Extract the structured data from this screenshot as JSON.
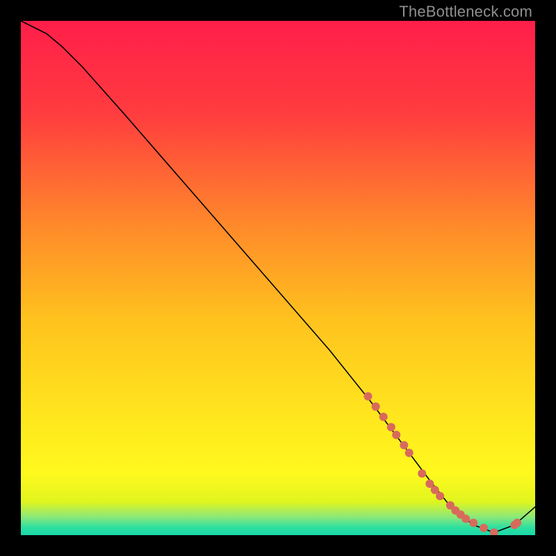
{
  "watermark": "TheBottleneck.com",
  "chart_data": {
    "type": "line",
    "title": "",
    "xlabel": "",
    "ylabel": "",
    "xlim": [
      0,
      100
    ],
    "ylim": [
      0,
      100
    ],
    "grid": false,
    "legend": false,
    "series": [
      {
        "name": "curve",
        "x": [
          0,
          2,
          5,
          8,
          12,
          20,
          30,
          40,
          50,
          60,
          68,
          74,
          80,
          84,
          88,
          92,
          96,
          100
        ],
        "y": [
          100,
          99,
          97.5,
          95,
          91,
          82,
          70.5,
          59,
          47.5,
          36,
          26,
          18,
          10,
          5,
          2,
          0.5,
          2,
          5.5
        ],
        "style": "line",
        "color": "#000000",
        "width": 1.6
      },
      {
        "name": "lower-scatter",
        "x": [
          67.5,
          69,
          70.5,
          72,
          73,
          74.5,
          75.5,
          78,
          79.5,
          80.5,
          81.5,
          83.5,
          84.5,
          85.5,
          86.5,
          88,
          90,
          92,
          96,
          96.5
        ],
        "y": [
          27,
          25,
          23,
          21,
          19.5,
          17.5,
          16,
          12,
          10,
          8.8,
          7.6,
          5.8,
          4.8,
          4.0,
          3.2,
          2.4,
          1.4,
          0.5,
          2,
          2.4
        ],
        "style": "scatter",
        "color": "#d86a5c",
        "radius": 6
      }
    ],
    "background_gradient": {
      "stops": [
        {
          "offset": 0.0,
          "color": "#ff1e4a"
        },
        {
          "offset": 0.18,
          "color": "#ff3c3f"
        },
        {
          "offset": 0.4,
          "color": "#ff8a2a"
        },
        {
          "offset": 0.58,
          "color": "#ffc21e"
        },
        {
          "offset": 0.78,
          "color": "#ffe81e"
        },
        {
          "offset": 0.88,
          "color": "#fff91e"
        },
        {
          "offset": 0.935,
          "color": "#e0f51e"
        },
        {
          "offset": 0.965,
          "color": "#8ae87a"
        },
        {
          "offset": 0.985,
          "color": "#2de0a0"
        },
        {
          "offset": 1.0,
          "color": "#19d8a8"
        }
      ]
    }
  }
}
